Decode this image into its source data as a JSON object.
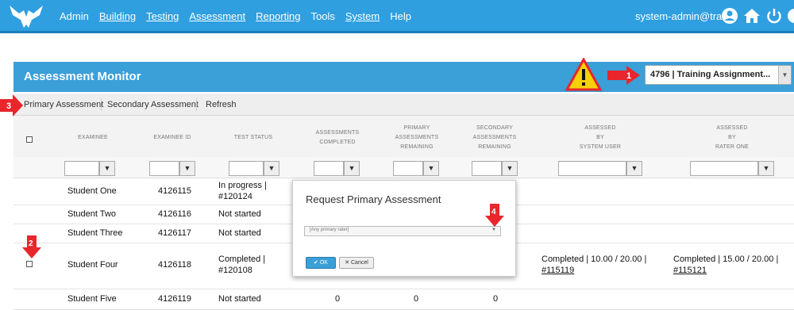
{
  "nav": {
    "items": [
      "Admin",
      "Building",
      "Testing",
      "Assessment",
      "Reporting",
      "Tools",
      "System",
      "Help"
    ],
    "user": "system-admin@train"
  },
  "panel": {
    "title": "Assessment Monitor",
    "assignment_selected": "4796 | Training Assignment..."
  },
  "toolbar": {
    "primary": "Primary Assessment",
    "secondary": "Secondary Assessment",
    "refresh": "Refresh"
  },
  "columns": {
    "examinee": "EXAMINEE",
    "examinee_id": "EXAMINEE ID",
    "test_status": "TEST STATUS",
    "assessments_completed": [
      "ASSESSMENTS",
      "COMPLETED"
    ],
    "primary_remaining": [
      "PRIMARY",
      "ASSESSMENTS",
      "REMAINING"
    ],
    "secondary_remaining": [
      "SECONDARY",
      "ASSESSMENTS",
      "REMAINING"
    ],
    "assessed_system": [
      "ASSESSED",
      "BY",
      "SYSTEM USER"
    ],
    "assessed_rater": [
      "ASSESSED",
      "BY",
      "RATER ONE"
    ]
  },
  "rows": [
    {
      "name": "Student One",
      "id": "4126115",
      "status1": "In progress |",
      "status2": "#120124"
    },
    {
      "name": "Student Two",
      "id": "4126116",
      "status1": "Not started",
      "status2": ""
    },
    {
      "name": "Student Three",
      "id": "4126117",
      "status1": "Not started",
      "status2": ""
    },
    {
      "name": "Student Four",
      "id": "4126118",
      "status1": "Completed |",
      "status2": "#120108",
      "system1": "Completed | 10.00 / 20.00 |",
      "system2": "#115119",
      "rater1": "Completed | 15.00 / 20.00 |",
      "rater2": "#115121"
    },
    {
      "name": "Student Five",
      "id": "4126119",
      "status1": "Not started",
      "status2": "",
      "completed": "0",
      "primary": "0",
      "secondary": "0"
    }
  ],
  "modal": {
    "title": "Request Primary Assessment",
    "select_placeholder": "[Any primary rater]",
    "ok": "OK",
    "cancel": "Cancel"
  },
  "annotations": [
    "1",
    "2",
    "3",
    "4"
  ],
  "colors": {
    "nav": "#2f9fe0",
    "panel": "#3b9fd8",
    "marker": "#e8262b",
    "warning": "#f5d10a"
  }
}
